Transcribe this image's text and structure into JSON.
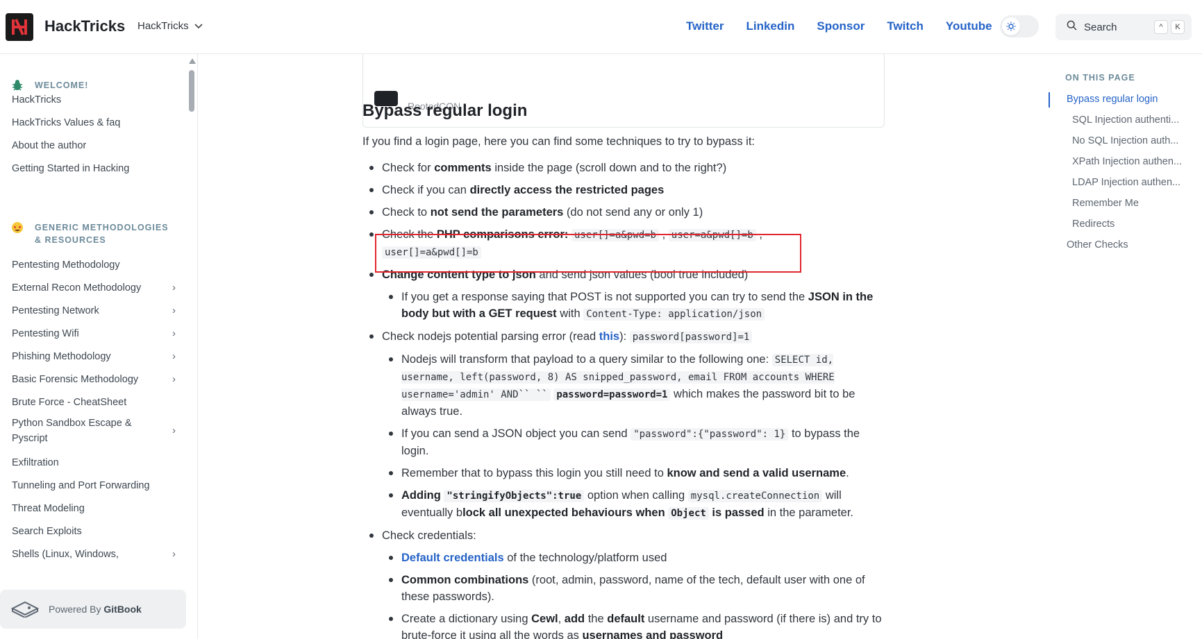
{
  "header": {
    "brand": "HackTricks",
    "space_selector": "HackTricks",
    "nav_links": [
      "Twitter",
      "Linkedin",
      "Sponsor",
      "Twitch",
      "Youtube"
    ],
    "search_label": "Search",
    "search_shortcut": [
      "^",
      "K"
    ]
  },
  "sidebar": {
    "section_welcome": "WELCOME!",
    "welcome_items": [
      "HackTricks",
      "HackTricks Values & faq",
      "About the author",
      "Getting Started in Hacking"
    ],
    "section_generic": "GENERIC METHODOLOGIES & RESOURCES",
    "generic_items": [
      {
        "label": "Pentesting Methodology",
        "expandable": false
      },
      {
        "label": "External Recon Methodology",
        "expandable": true
      },
      {
        "label": "Pentesting Network",
        "expandable": true
      },
      {
        "label": "Pentesting Wifi",
        "expandable": true
      },
      {
        "label": "Phishing Methodology",
        "expandable": true
      },
      {
        "label": "Basic Forensic Methodology",
        "expandable": true
      },
      {
        "label": "Brute Force - CheatSheet",
        "expandable": false
      },
      {
        "label": "Python Sandbox Escape & Pyscript",
        "expandable": true
      },
      {
        "label": "Exfiltration",
        "expandable": false
      },
      {
        "label": "Tunneling and Port Forwarding",
        "expandable": false
      },
      {
        "label": "Threat Modeling",
        "expandable": false
      },
      {
        "label": "Search Exploits",
        "expandable": false
      },
      {
        "label": "Shells (Linux, Windows,",
        "expandable": true
      }
    ],
    "powered_prefix": "Powered By",
    "powered_brand": "GitBook"
  },
  "main": {
    "card_caption": "RootedCON",
    "heading": "Bypass regular login",
    "intro": "If you find a login page, here you can find some techniques to try to bypass it:",
    "b1": {
      "pre": "Check for ",
      "bold": "comments",
      "post": " inside the page (scroll down and to the right?)"
    },
    "b2": {
      "pre": "Check if you can ",
      "bold": "directly access the restricted pages"
    },
    "b3": {
      "pre": "Check to ",
      "bold": "not send the parameters",
      "post": " (do not send any or only 1)"
    },
    "b4": {
      "pre": "Check the ",
      "bold": "PHP comparisons error:",
      "code1": "user[]=a&pwd=b",
      "sep1": " , ",
      "code2": "user=a&pwd[]=b",
      "sep2": " , ",
      "code3": "user[]=a&pwd[]=b"
    },
    "b5": {
      "bold": "Change content type to json",
      "post": " and send json values (bool true included)"
    },
    "b5a": {
      "pre": "If you get a response saying that POST is not supported you can try to send the ",
      "bold": "JSON in the body but with a GET request",
      "mid": " with ",
      "code": "Content-Type: application/json"
    },
    "b6": {
      "pre": "Check nodejs potential parsing error (read ",
      "link": "this",
      "mid": "): ",
      "code": "password[password]=1"
    },
    "b6a": {
      "pre": "Nodejs will transform that payload to a query similar to the following one: ",
      "code": "SELECT id, username, left(password, 8) AS snipped_password, email FROM accounts WHERE username='admin' AND`` ``",
      "code_bold": "password=password=1",
      "post": " which makes the password bit to be always true."
    },
    "b6b": {
      "pre": "If you can send a JSON object you can send ",
      "code": "\"password\":{\"password\": 1}",
      "post": " to bypass the login."
    },
    "b6c": {
      "pre": "Remember that to bypass this login you still need to ",
      "bold": "know and send a valid username",
      "post": "."
    },
    "b6d": {
      "bold1": "Adding ",
      "code_bold": "\"stringifyObjects\":true",
      "mid": " option when calling ",
      "code": "mysql.createConnection",
      "mid2": " will eventually b",
      "bold2": "lock all unexpected behaviours when ",
      "code_bold2": "Object",
      "bold3": " is passed",
      "post": " in the parameter."
    },
    "b7": "Check credentials:",
    "b7a": {
      "link": "Default credentials",
      "post": " of the technology/platform used"
    },
    "b7b": {
      "bold": "Common combinations",
      "post": " (root, admin, password, name of the tech, default user with one of these passwords)."
    },
    "b7c": {
      "pre": "Create a dictionary using ",
      "bold1": "Cewl",
      "sep": ", ",
      "bold2": "add",
      "mid": " the ",
      "bold3": "default",
      "mid2": " username and password (if there is) and try to brute-force it using all the words as ",
      "bold4": "usernames and password"
    }
  },
  "toc": {
    "title": "ON THIS PAGE",
    "items": [
      "Bypass regular login",
      "SQL Injection authenti...",
      "No SQL Injection auth...",
      "XPath Injection authen...",
      "LDAP Injection authen...",
      "Remember Me",
      "Redirects",
      "Other Checks"
    ]
  },
  "colors": {
    "link": "#2563c7",
    "highlight_border": "#e0262f",
    "section_heading": "#6c8a9a"
  }
}
